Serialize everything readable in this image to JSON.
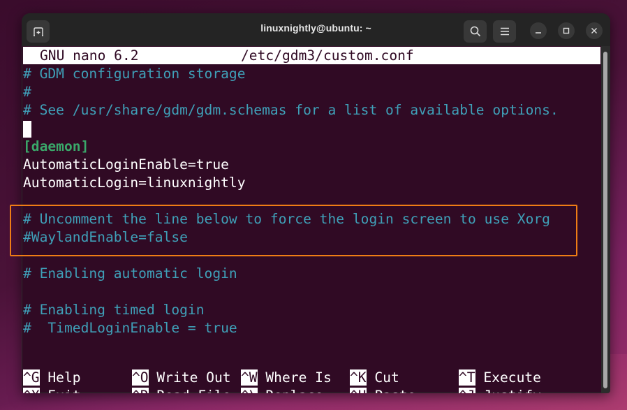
{
  "window": {
    "title": "linuxnightly@ubuntu: ~",
    "buttons": {
      "new_tab": "new-tab-icon",
      "search": "search-icon",
      "menu": "hamburger-menu-icon",
      "minimize": "minimize-icon",
      "maximize": "maximize-icon",
      "close": "close-icon"
    }
  },
  "nano": {
    "version": "GNU nano 6.2",
    "filename": "/etc/gdm3/custom.conf",
    "lines": [
      {
        "text": "# GDM configuration storage",
        "type": "comment"
      },
      {
        "text": "#",
        "type": "comment"
      },
      {
        "text": "# See /usr/share/gdm/gdm.schemas for a list of available options.",
        "type": "comment"
      },
      {
        "text": "",
        "type": "cursor"
      },
      {
        "text": "[daemon]",
        "type": "section"
      },
      {
        "text": "AutomaticLoginEnable=true",
        "type": "plain"
      },
      {
        "text": "AutomaticLogin=linuxnightly",
        "type": "plain"
      },
      {
        "text": "",
        "type": "blank"
      },
      {
        "text": "# Uncomment the line below to force the login screen to use Xorg",
        "type": "comment"
      },
      {
        "text": "#WaylandEnable=false",
        "type": "comment"
      },
      {
        "text": "",
        "type": "blank"
      },
      {
        "text": "# Enabling automatic login",
        "type": "comment"
      },
      {
        "text": "",
        "type": "blank"
      },
      {
        "text": "# Enabling timed login",
        "type": "comment"
      },
      {
        "text": "#  TimedLoginEnable = true",
        "type": "comment"
      }
    ],
    "shortcuts": [
      [
        {
          "key": "^G",
          "label": "Help"
        },
        {
          "key": "^O",
          "label": "Write Out"
        },
        {
          "key": "^W",
          "label": "Where Is"
        },
        {
          "key": "^K",
          "label": "Cut"
        },
        {
          "key": "^T",
          "label": "Execute"
        }
      ],
      [
        {
          "key": "^X",
          "label": "Exit"
        },
        {
          "key": "^R",
          "label": "Read File"
        },
        {
          "key": "^\\",
          "label": "Replace"
        },
        {
          "key": "^U",
          "label": "Paste"
        },
        {
          "key": "^J",
          "label": "Justify"
        }
      ]
    ]
  },
  "annotation": {
    "highlight_color": "#ef7d15",
    "highlight_target": "WaylandEnable lines"
  },
  "colors": {
    "terminal_bg": "#300a24",
    "comment": "#3fa0b8",
    "section": "#3aa86a",
    "text": "#ffffff"
  }
}
